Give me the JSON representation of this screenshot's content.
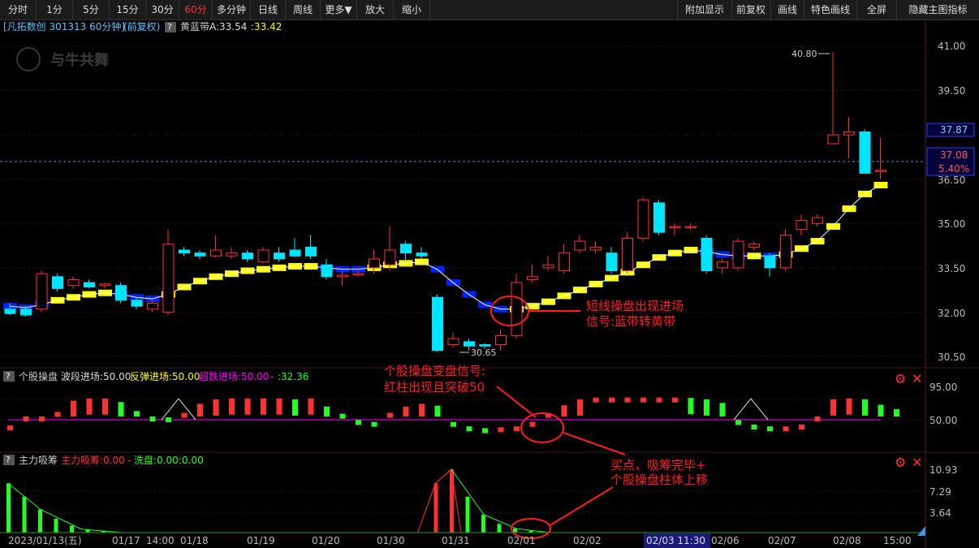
{
  "toolbar": {
    "left": [
      "分时",
      "1分",
      "5分",
      "15分",
      "30分",
      "60分",
      "多分钟",
      "日线",
      "周线",
      "更多▼",
      "放大",
      "缩小"
    ],
    "active": "60分",
    "right": [
      "附加显示",
      "前复权",
      "画线",
      "特色画线",
      "全屏",
      "隐藏主图指标"
    ]
  },
  "main_header": {
    "title": "[凡拓数创 301313 60分钟]",
    "adj": "(前复权)",
    "question": "?",
    "indicator": "黄蓝带",
    "a_label": "A:33.54",
    "b_value": ":33.42"
  },
  "logo_text": "与牛共舞",
  "price_axis": [
    "41.00",
    "39.50",
    "37.87",
    "37.08",
    "5.40%",
    "36.50",
    "35.00",
    "33.50",
    "32.00",
    "30.50"
  ],
  "price_high_label": "40.80",
  "price_low_label": "30.65",
  "annotations": {
    "a1_line1": "短线操盘出现进场",
    "a1_line2": "信号:蓝带转黄带",
    "a2_line1": "个股操盘变盘信号:",
    "a2_line2": "红柱出现且突破50",
    "a3_line1": "买点，吸筹完毕+",
    "a3_line2": "个股操盘柱体上移"
  },
  "osc_header": {
    "question": "?",
    "name": "个股操盘",
    "wave": "波段进场:50.00",
    "rebound": "反弹进场:50.00",
    "oversold": "超跌进场:50.00",
    "dash": "-",
    "value": ":32.36"
  },
  "osc_axis": [
    "95.00",
    "50.00"
  ],
  "acc_header": {
    "question": "?",
    "name": "主力吸筹",
    "acc": "主力吸筹:0.00",
    "dash": "-",
    "wash": "洗盘:0.00",
    "value": ":0.00"
  },
  "acc_axis": [
    "10.93",
    "7.29",
    "3.64"
  ],
  "x_labels": [
    "2023/01/13(五)",
    "01/17",
    "14:00",
    "01/18",
    "01/19",
    "01/20",
    "01/30",
    "01/31",
    "02/01",
    "02/02",
    "02/03 11:30",
    "02/06",
    "02/07",
    "02/08",
    "15:00"
  ],
  "colors": {
    "up": "#ff3232",
    "down": "#00e5ff",
    "yellow_band": "#ffff00",
    "blue_band": "#0022ff",
    "osc_line": "#ff00ff",
    "annotation": "#ff2020",
    "acc_green": "#22ff22"
  },
  "chart_data": {
    "type": "candlestick",
    "ylim": [
      30.0,
      41.6
    ],
    "candles": [
      [
        32.1,
        31.95,
        32.3,
        31.9
      ],
      [
        32.1,
        31.9,
        32.2,
        31.85
      ],
      [
        32.1,
        33.3,
        33.4,
        32.0
      ],
      [
        33.2,
        32.8,
        33.3,
        32.7
      ],
      [
        32.9,
        33.1,
        33.2,
        32.8
      ],
      [
        33.0,
        32.85,
        33.1,
        32.8
      ],
      [
        32.9,
        32.95,
        33.0,
        32.8
      ],
      [
        32.9,
        32.4,
        33.0,
        32.3
      ],
      [
        32.4,
        32.2,
        32.5,
        32.1
      ],
      [
        32.1,
        32.3,
        32.4,
        32.0
      ],
      [
        32.0,
        34.3,
        34.8,
        31.9
      ],
      [
        34.1,
        34.0,
        34.2,
        33.9
      ],
      [
        34.0,
        33.9,
        34.1,
        33.8
      ],
      [
        33.9,
        34.1,
        34.6,
        33.85
      ],
      [
        33.9,
        34.0,
        34.2,
        33.8
      ],
      [
        34.0,
        33.8,
        34.1,
        33.7
      ],
      [
        33.7,
        34.1,
        34.2,
        33.65
      ],
      [
        34.0,
        33.8,
        34.2,
        33.7
      ],
      [
        34.1,
        33.9,
        34.5,
        33.85
      ],
      [
        34.2,
        33.9,
        34.6,
        33.8
      ],
      [
        33.6,
        33.2,
        33.8,
        33.1
      ],
      [
        33.2,
        33.25,
        33.4,
        32.9
      ],
      [
        33.3,
        33.3,
        33.5,
        33.2
      ],
      [
        33.5,
        33.8,
        34.1,
        33.3
      ],
      [
        33.6,
        34.1,
        34.9,
        33.4
      ],
      [
        34.3,
        34.0,
        34.4,
        33.7
      ],
      [
        34.0,
        33.9,
        34.2,
        33.8
      ],
      [
        32.5,
        30.7,
        32.6,
        30.65
      ],
      [
        30.9,
        31.1,
        31.3,
        30.8
      ],
      [
        31.0,
        30.85,
        31.1,
        30.7
      ],
      [
        30.9,
        30.85,
        30.95,
        30.75
      ],
      [
        30.9,
        31.2,
        31.4,
        30.7
      ],
      [
        31.2,
        33.0,
        33.3,
        31.1
      ],
      [
        33.1,
        33.2,
        33.6,
        33.0
      ],
      [
        33.5,
        33.6,
        33.9,
        33.4
      ],
      [
        33.4,
        34.0,
        34.3,
        33.3
      ],
      [
        34.1,
        34.4,
        34.6,
        34.0
      ],
      [
        34.1,
        34.2,
        34.4,
        34.0
      ],
      [
        34.0,
        33.4,
        34.2,
        33.3
      ],
      [
        33.4,
        34.5,
        34.7,
        33.3
      ],
      [
        34.5,
        35.8,
        35.9,
        34.4
      ],
      [
        35.7,
        34.7,
        35.8,
        34.6
      ],
      [
        34.9,
        34.9,
        35.0,
        34.6
      ],
      [
        34.9,
        34.9,
        35.0,
        34.8
      ],
      [
        34.5,
        33.4,
        34.6,
        33.3
      ],
      [
        33.5,
        33.7,
        33.8,
        33.3
      ],
      [
        33.5,
        34.4,
        34.5,
        33.4
      ],
      [
        34.2,
        34.3,
        34.4,
        34.1
      ],
      [
        33.9,
        33.5,
        34.0,
        33.2
      ],
      [
        33.5,
        34.6,
        34.8,
        33.4
      ],
      [
        34.8,
        35.1,
        35.3,
        34.6
      ],
      [
        35.0,
        35.2,
        35.3,
        34.9
      ],
      [
        37.7,
        38.0,
        40.8,
        37.7
      ],
      [
        38.0,
        38.1,
        38.6,
        37.2
      ],
      [
        38.1,
        36.7,
        38.2,
        36.7
      ],
      [
        36.8,
        36.8,
        37.9,
        36.5
      ]
    ],
    "band": [
      32.2,
      32.15,
      32.25,
      32.4,
      32.5,
      32.6,
      32.65,
      32.6,
      32.5,
      32.45,
      32.6,
      32.85,
      33.05,
      33.2,
      33.3,
      33.4,
      33.45,
      33.5,
      33.55,
      33.55,
      33.5,
      33.45,
      33.45,
      33.5,
      33.6,
      33.65,
      33.7,
      33.45,
      33.0,
      32.6,
      32.25,
      32.1,
      32.1,
      32.2,
      32.35,
      32.55,
      32.75,
      32.95,
      33.15,
      33.35,
      33.6,
      33.85,
      34.0,
      34.1,
      34.05,
      33.95,
      33.9,
      33.9,
      33.9,
      33.95,
      34.15,
      34.4,
      34.9,
      35.5,
      36.0,
      36.3
    ],
    "band_color": [
      "b",
      "b",
      "b",
      "y",
      "y",
      "y",
      "y",
      "b",
      "b",
      "b",
      "y",
      "y",
      "y",
      "y",
      "y",
      "y",
      "y",
      "y",
      "y",
      "y",
      "b",
      "b",
      "b",
      "y",
      "y",
      "y",
      "y",
      "b",
      "b",
      "b",
      "b",
      "b",
      "y",
      "y",
      "y",
      "y",
      "y",
      "y",
      "y",
      "y",
      "y",
      "y",
      "y",
      "y",
      "b",
      "b",
      "b",
      "y",
      "b",
      "y",
      "y",
      "y",
      "y",
      "y",
      "y",
      "y"
    ],
    "osc": [
      30,
      50,
      50,
      60,
      85,
      90,
      90,
      82,
      62,
      50,
      48,
      58,
      78,
      88,
      90,
      90,
      90,
      90,
      88,
      90,
      72,
      56,
      42,
      38,
      58,
      72,
      78,
      74,
      38,
      28,
      24,
      26,
      28,
      38,
      58,
      75,
      88,
      92,
      92,
      92,
      92,
      92,
      92,
      91,
      88,
      80,
      42,
      32,
      28,
      28,
      32,
      50,
      88,
      90,
      88,
      76,
      66
    ],
    "acc": [
      8.5,
      6.2,
      4.0,
      2.4,
      1.2,
      0.6,
      0.2,
      0,
      0,
      0,
      0,
      0,
      0,
      0,
      0,
      0,
      0,
      0,
      0,
      0,
      0,
      0,
      0,
      0,
      0,
      0,
      0,
      8.5,
      10.93,
      6.2,
      3.1,
      1.5,
      0.7,
      0.3,
      0,
      0,
      0,
      0,
      0,
      0,
      0,
      0,
      0,
      0,
      0,
      0,
      0,
      0,
      0,
      0,
      0,
      0,
      0,
      0,
      0,
      0,
      0
    ]
  }
}
